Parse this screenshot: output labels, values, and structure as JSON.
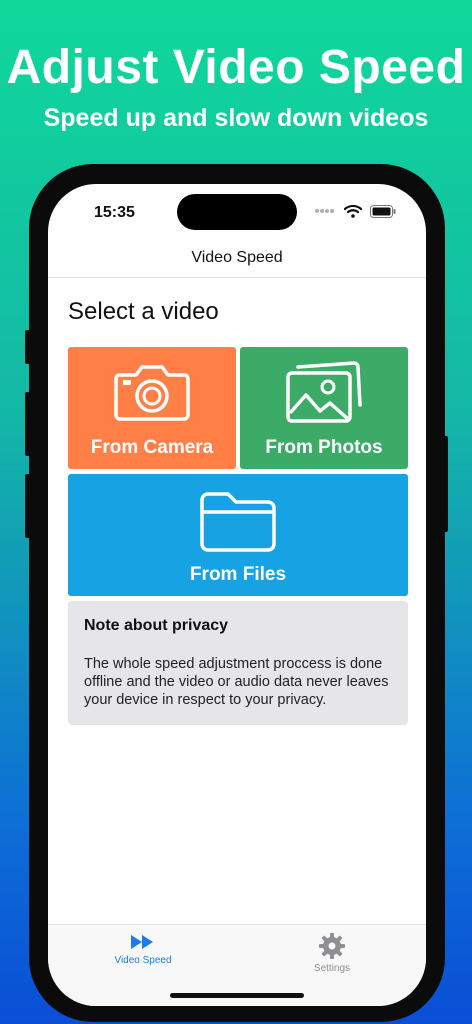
{
  "promo": {
    "headline": "Adjust Video Speed",
    "subheadline": "Speed up and slow down videos"
  },
  "status_bar": {
    "time": "15:35",
    "icons": [
      "signal-dots-icon",
      "wifi-icon",
      "battery-icon"
    ]
  },
  "nav": {
    "title": "Video Speed"
  },
  "main": {
    "section_title": "Select a video",
    "sources": [
      {
        "label": "From Camera",
        "icon": "camera-icon",
        "color": "#ff7f46"
      },
      {
        "label": "From Photos",
        "icon": "photos-icon",
        "color": "#3dab68"
      },
      {
        "label": "From Files",
        "icon": "folder-icon",
        "color": "#16a2e3"
      }
    ]
  },
  "privacy": {
    "title": "Note about privacy",
    "body": "The whole speed adjustment proccess is done offline and the video or audio data never leaves your device in respect to your privacy."
  },
  "tab_bar": {
    "tabs": [
      {
        "label": "Video Speed",
        "icon": "fast-forward-icon",
        "active": true,
        "color": "#1a7cf0"
      },
      {
        "label": "Settings",
        "icon": "gear-icon",
        "active": false,
        "color": "#8e8e93"
      }
    ]
  }
}
